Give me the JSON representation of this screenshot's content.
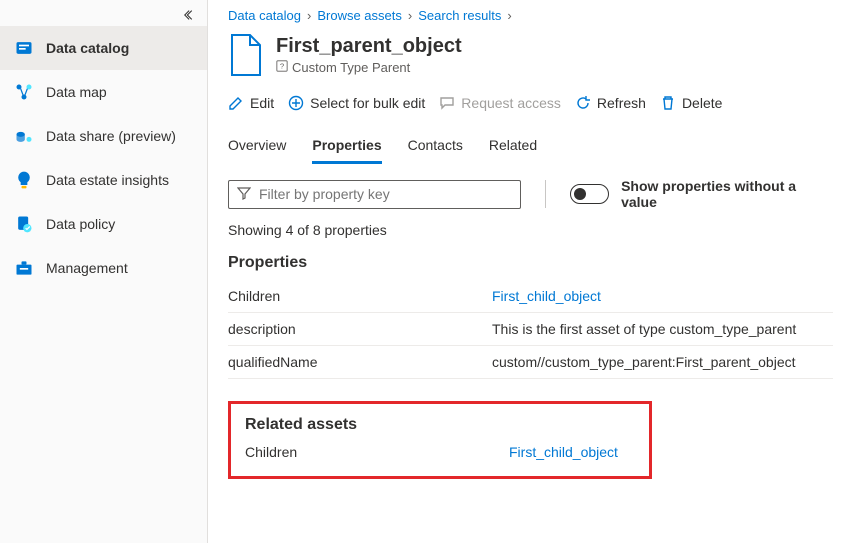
{
  "sidebar": {
    "items": [
      {
        "label": "Data catalog"
      },
      {
        "label": "Data map"
      },
      {
        "label": "Data share (preview)"
      },
      {
        "label": "Data estate insights"
      },
      {
        "label": "Data policy"
      },
      {
        "label": "Management"
      }
    ]
  },
  "breadcrumb": {
    "items": [
      "Data catalog",
      "Browse assets",
      "Search results"
    ]
  },
  "asset": {
    "title": "First_parent_object",
    "type_label": "Custom Type Parent"
  },
  "toolbar": {
    "edit": "Edit",
    "select_bulk": "Select for bulk edit",
    "request_access": "Request access",
    "refresh": "Refresh",
    "delete": "Delete"
  },
  "tabs": {
    "overview": "Overview",
    "properties": "Properties",
    "contacts": "Contacts",
    "related": "Related"
  },
  "filter": {
    "placeholder": "Filter by property key",
    "status": "Showing 4 of 8 properties",
    "toggle_label": "Show properties without a value"
  },
  "sections": {
    "properties_title": "Properties",
    "related_title": "Related assets"
  },
  "properties": [
    {
      "key": "Children",
      "value": "First_child_object",
      "link": true
    },
    {
      "key": "description",
      "value": "This is the first asset of type custom_type_parent",
      "link": false
    },
    {
      "key": "qualifiedName",
      "value": "custom//custom_type_parent:First_parent_object",
      "link": false
    }
  ],
  "related_assets": [
    {
      "key": "Children",
      "value": "First_child_object"
    }
  ]
}
